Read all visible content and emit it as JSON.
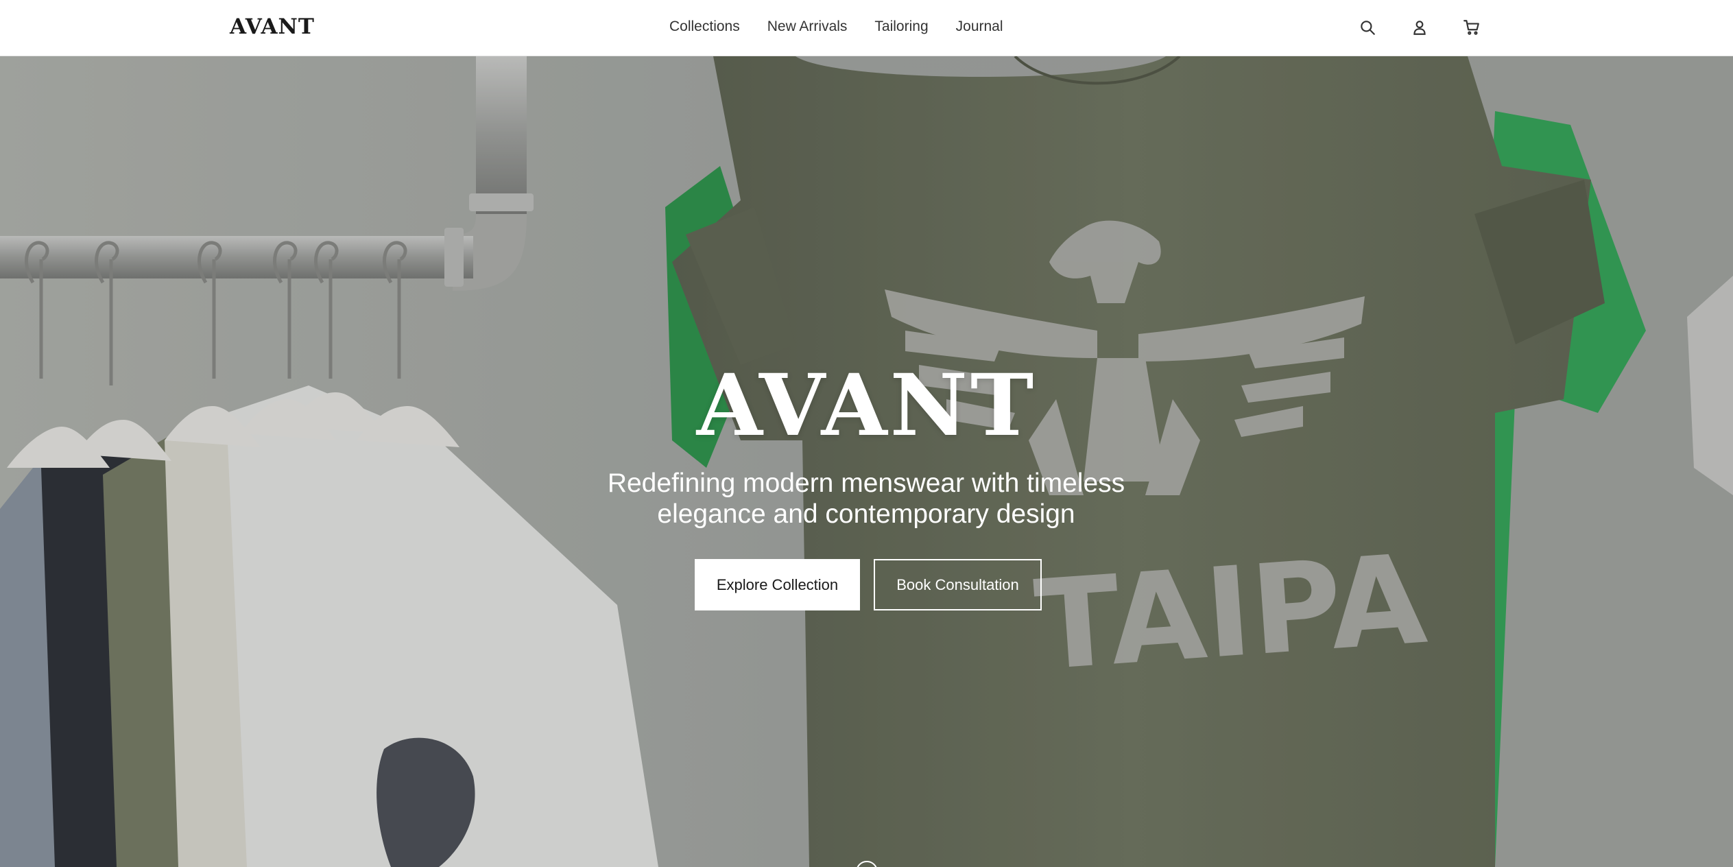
{
  "header": {
    "logo": "AVANT",
    "nav": [
      {
        "label": "Collections"
      },
      {
        "label": "New Arrivals"
      },
      {
        "label": "Tailoring"
      },
      {
        "label": "Journal"
      }
    ],
    "icons": [
      "search-icon",
      "user-icon",
      "cart-icon"
    ]
  },
  "hero": {
    "title": "AVANT",
    "subtitle": "Redefining modern menswear with timeless elegance and contemporary design",
    "primary_button": "Explore Collection",
    "secondary_button": "Book Consultation",
    "background_image_text": "TAIPA"
  },
  "colors": {
    "header_bg": "#ffffff",
    "text_dark": "#1a1a1a",
    "shirt_olive": "#6f7560",
    "accent_green": "#2faa55",
    "hero_text": "#ffffff"
  }
}
